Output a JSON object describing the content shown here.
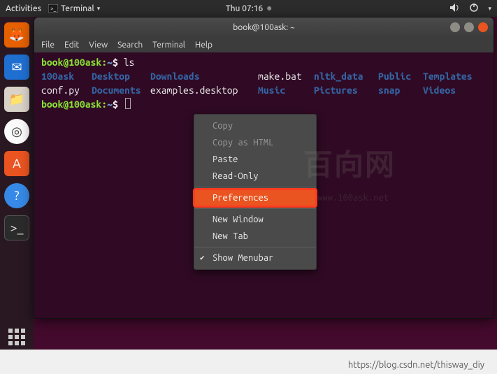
{
  "top_bar": {
    "activities": "Activities",
    "app_name": "Terminal",
    "clock": "Thu 07:16"
  },
  "window": {
    "title": "book@100ask: ~"
  },
  "menubar": {
    "items": [
      "File",
      "Edit",
      "View",
      "Search",
      "Terminal",
      "Help"
    ]
  },
  "terminal": {
    "prompt_user": "book@100ask",
    "prompt_path": "~",
    "prompt_symbol": "$",
    "command": "ls",
    "listing_row1": [
      "100ask",
      "Desktop",
      "Downloads",
      "make.bat",
      "nltk_data",
      "Public",
      "Templates"
    ],
    "listing_row1_types": [
      "dir",
      "dir",
      "dir",
      "file",
      "dir",
      "dir",
      "dir"
    ],
    "listing_row2": [
      "conf.py",
      "Documents",
      "examples.desktop",
      "Music",
      "Pictures",
      "snap",
      "Videos"
    ],
    "listing_row2_types": [
      "file",
      "dir",
      "file",
      "dir",
      "dir",
      "dir",
      "dir"
    ]
  },
  "context_menu": {
    "items": [
      {
        "label": "Copy",
        "enabled": false
      },
      {
        "label": "Copy as HTML",
        "enabled": false
      },
      {
        "label": "Paste",
        "enabled": true
      },
      {
        "label": "Read-Only",
        "enabled": true,
        "separator_after": true
      },
      {
        "label": "Preferences",
        "enabled": true,
        "highlight": true,
        "separator_after": true
      },
      {
        "label": "New Window",
        "enabled": true
      },
      {
        "label": "New Tab",
        "enabled": true,
        "separator_after": true
      },
      {
        "label": "Show Menubar",
        "enabled": true,
        "checked": true
      }
    ]
  },
  "watermark": {
    "main": "百向网",
    "sub": "www.100ask.net"
  },
  "footer_url": "https://blog.csdn.net/thisway_diy"
}
